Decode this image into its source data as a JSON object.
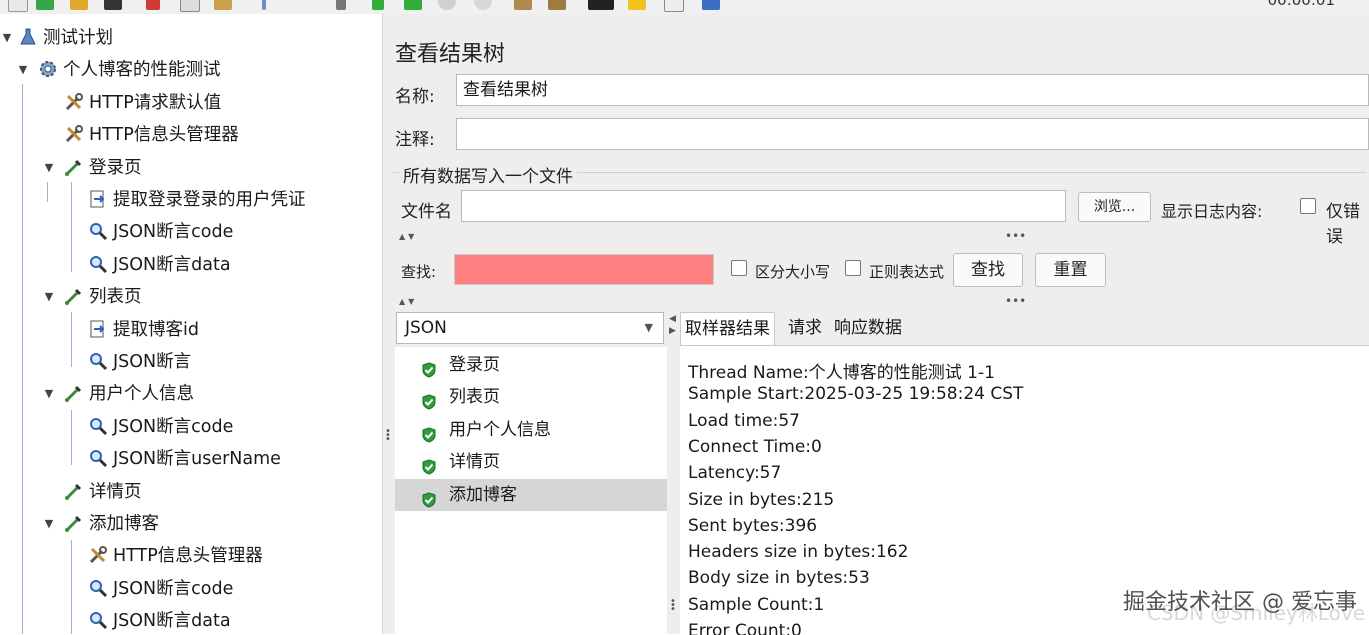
{
  "toolbar": {
    "timer": "00:00:01",
    "icons": [
      "new-icon",
      "templates-icon",
      "open-icon",
      "save-icon",
      "cut-icon",
      "copy-icon",
      "paste-icon",
      "expand-icon",
      "toggle-icon",
      "start-icon",
      "start-no-pause-icon",
      "stop-icon",
      "shutdown-icon",
      "clear-icon",
      "clear-all-icon",
      "search-icon",
      "reset-search-icon",
      "function-helper-icon",
      "help-icon"
    ]
  },
  "tree": {
    "nodes": [
      {
        "label": "测试计划",
        "icon": "flask-icon",
        "level": 0,
        "expanded": true
      },
      {
        "label": "个人博客的性能测试",
        "icon": "gear-icon",
        "level": 1,
        "expanded": true
      },
      {
        "label": "HTTP请求默认值",
        "icon": "wrench-icon",
        "level": 2
      },
      {
        "label": "HTTP信息头管理器",
        "icon": "wrench-icon",
        "level": 2
      },
      {
        "label": "登录页",
        "icon": "pipette-icon",
        "level": 2,
        "expanded": true
      },
      {
        "label": "提取登录登录的用户凭证",
        "icon": "extractor-icon",
        "level": 3
      },
      {
        "label": "JSON断言code",
        "icon": "magnifier-icon",
        "level": 3
      },
      {
        "label": "JSON断言data",
        "icon": "magnifier-icon",
        "level": 3
      },
      {
        "label": "列表页",
        "icon": "pipette-icon",
        "level": 2,
        "expanded": true
      },
      {
        "label": "提取博客id",
        "icon": "extractor-icon",
        "level": 3
      },
      {
        "label": "JSON断言",
        "icon": "magnifier-icon",
        "level": 3
      },
      {
        "label": "用户个人信息",
        "icon": "pipette-icon",
        "level": 2,
        "expanded": true
      },
      {
        "label": "JSON断言code",
        "icon": "magnifier-icon",
        "level": 3
      },
      {
        "label": "JSON断言userName",
        "icon": "magnifier-icon",
        "level": 3
      },
      {
        "label": "详情页",
        "icon": "pipette-icon",
        "level": 2
      },
      {
        "label": "添加博客",
        "icon": "pipette-icon",
        "level": 2,
        "expanded": true
      },
      {
        "label": "HTTP信息头管理器",
        "icon": "wrench-icon",
        "level": 3
      },
      {
        "label": "JSON断言code",
        "icon": "magnifier-icon",
        "level": 3
      },
      {
        "label": "JSON断言data",
        "icon": "magnifier-icon",
        "level": 3
      }
    ]
  },
  "panel": {
    "title": "查看结果树",
    "name_label": "名称:",
    "name_value": "查看结果树",
    "comment_label": "注释:",
    "comment_value": "",
    "file_group_label": "所有数据写入一个文件",
    "filename_label": "文件名",
    "filename_value": "",
    "browse_button": "浏览...",
    "log_label": "显示日志内容:",
    "errors_only_label": "仅错误",
    "search_label": "查找:",
    "search_value": "",
    "case_sensitive_label": "区分大小写",
    "regex_label": "正则表达式",
    "find_button": "查找",
    "reset_button": "重置"
  },
  "results": {
    "renderer": "JSON",
    "samples": [
      {
        "label": "登录页",
        "status": "success"
      },
      {
        "label": "列表页",
        "status": "success"
      },
      {
        "label": "用户个人信息",
        "status": "success"
      },
      {
        "label": "详情页",
        "status": "success"
      },
      {
        "label": "添加博客",
        "status": "success",
        "selected": true
      }
    ],
    "tabs": [
      "取样器结果",
      "请求",
      "响应数据"
    ],
    "active_tab": "取样器结果",
    "sampler_lines": [
      "Thread Name:个人博客的性能测试 1-1",
      "Sample Start:2025-03-25 19:58:24 CST",
      "Load time:57",
      "Connect Time:0",
      "Latency:57",
      "Size in bytes:215",
      "Sent bytes:396",
      "Headers size in bytes:162",
      "Body size in bytes:53",
      "Sample Count:1",
      "Error Count:0"
    ]
  },
  "colors": {
    "search_field_bg": "#ff8080",
    "success_icon": "#2e9e3a",
    "selection_bg": "#d6d6d6"
  },
  "watermark": {
    "text": "掘金技术社区 @ 爱忘事",
    "text2": "CSDN @Smiley林Love"
  }
}
